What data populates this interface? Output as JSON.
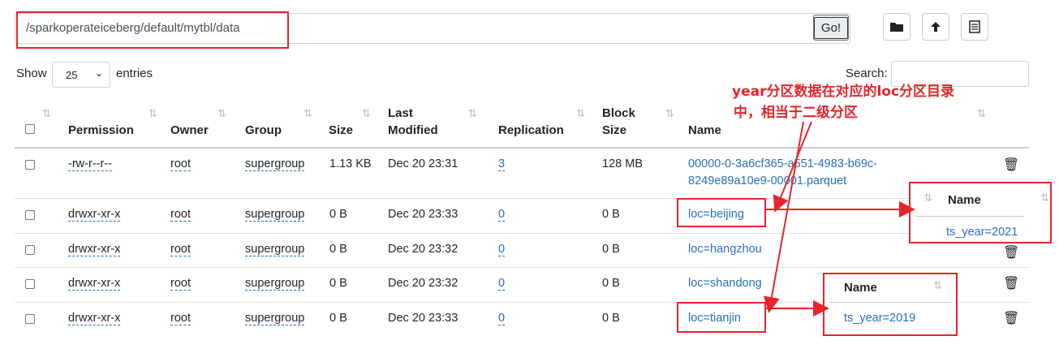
{
  "path": {
    "value": "/sparkoperateiceberg/default/mytbl/data",
    "go_label": "Go!"
  },
  "controls": {
    "show_label": "Show",
    "page_size": "25",
    "entries_label": "entries",
    "search_label": "Search:"
  },
  "columns": {
    "permission": "Permission",
    "owner": "Owner",
    "group": "Group",
    "size": "Size",
    "last_modified_1": "Last",
    "last_modified_2": "Modified",
    "replication": "Replication",
    "block_size_1": "Block",
    "block_size_2": "Size",
    "name": "Name"
  },
  "rows": [
    {
      "permission": "-rw-r--r--",
      "owner": "root",
      "group": "supergroup",
      "size": "1.13 KB",
      "modified": "Dec 20 23:31",
      "replication": "3",
      "block": "128 MB",
      "name_1": "00000-0-3a6cf365-a551-4983-b69c-",
      "name_2": "8249e89a10e9-00001.parquet"
    },
    {
      "permission": "drwxr-xr-x",
      "owner": "root",
      "group": "supergroup",
      "size": "0 B",
      "modified": "Dec 20 23:33",
      "replication": "0",
      "block": "0 B",
      "name_1": "loc=beijing"
    },
    {
      "permission": "drwxr-xr-x",
      "owner": "root",
      "group": "supergroup",
      "size": "0 B",
      "modified": "Dec 20 23:32",
      "replication": "0",
      "block": "0 B",
      "name_1": "loc=hangzhou"
    },
    {
      "permission": "drwxr-xr-x",
      "owner": "root",
      "group": "supergroup",
      "size": "0 B",
      "modified": "Dec 20 23:32",
      "replication": "0",
      "block": "0 B",
      "name_1": "loc=shandong"
    },
    {
      "permission": "drwxr-xr-x",
      "owner": "root",
      "group": "supergroup",
      "size": "0 B",
      "modified": "Dec 20 23:33",
      "replication": "0",
      "block": "0 B",
      "name_1": "loc=tianjin"
    }
  ],
  "annotation": {
    "line1": "year分区数据在对应的loc分区目录",
    "line2": "中，相当于二级分区"
  },
  "popup_a": {
    "header": "Name",
    "value": "ts_year=2021"
  },
  "popup_b": {
    "header": "Name",
    "value": "ts_year=2019"
  },
  "colors": {
    "link": "#2a6ebb",
    "annotation": "#e5252a"
  }
}
